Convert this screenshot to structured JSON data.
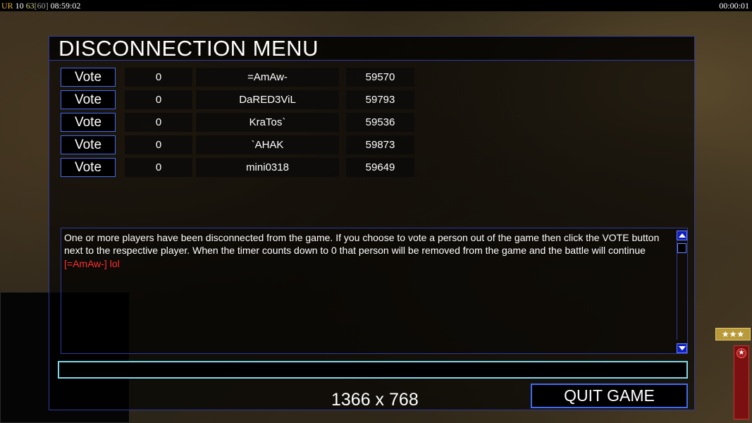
{
  "hud": {
    "faction": "UR",
    "fps": "10",
    "fps_extra": "63",
    "fps_cap": "[60]",
    "clock": "08:59:02",
    "game_timer": "00:00:01"
  },
  "dialog": {
    "title": "DISCONNECTION MENU",
    "vote_label": "Vote",
    "players": [
      {
        "count": "0",
        "name": "=AmAw-",
        "ping": "59570"
      },
      {
        "count": "0",
        "name": "DaRED3ViL",
        "ping": "59793"
      },
      {
        "count": "0",
        "name": "KraTos`",
        "ping": "59536"
      },
      {
        "count": "0",
        "name": "`AHAK",
        "ping": "59873"
      },
      {
        "count": "0",
        "name": "mini0318",
        "ping": "59649"
      }
    ],
    "info_text": "One or more players have been disconnected from the game. If you choose to vote a person out of the game then click the VOTE button next to the respective player. When the timer counts down to 0 that person will be removed from the game and the battle will continue",
    "chat_message": "[=AmAw-] lol",
    "chat_input_value": "",
    "resolution": "1366 x 768",
    "quit_label": "QUIT GAME"
  },
  "colors": {
    "panel_border": "#2f3aa0",
    "button_border": "#3f6cf0",
    "input_border": "#7fd8ec",
    "chat_message": "#ff3030"
  },
  "icons": {
    "scroll_up": "arrow-up-icon",
    "scroll_down": "arrow-down-icon",
    "rank": "rank-stars-icon",
    "general": "star-icon"
  },
  "rank_stars": "★★★"
}
